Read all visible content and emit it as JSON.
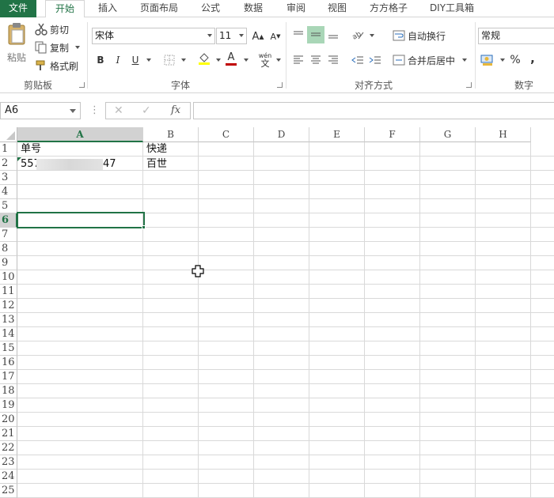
{
  "tabs": [
    "文件",
    "开始",
    "插入",
    "页面布局",
    "公式",
    "数据",
    "审阅",
    "视图",
    "方方格子",
    "DIY工具箱"
  ],
  "clipboard": {
    "paste_label": "粘贴",
    "cut_label": "剪切",
    "copy_label": "复制",
    "format_painter_label": "格式刷",
    "group_label": "剪贴板"
  },
  "font": {
    "name": "宋体",
    "size": "11",
    "grow_label": "A",
    "shrink_label": "A",
    "bold": "B",
    "italic": "I",
    "underline": "U",
    "font_color_label": "A",
    "phonetic_label": "wén",
    "phonetic_sub": "文",
    "group_label": "字体"
  },
  "alignment": {
    "wrap_label": "自动换行",
    "merge_label": "合并后居中",
    "group_label": "对齐方式"
  },
  "number": {
    "format": "常规",
    "percent": "%",
    "comma": ",",
    "group_label": "数字"
  },
  "formula_bar": {
    "name_box": "A6",
    "fx": "fx",
    "cancel": "✕",
    "enter": "✓",
    "menu": "⋮",
    "content": ""
  },
  "columns": [
    "A",
    "B",
    "C",
    "D",
    "E",
    "F",
    "G",
    "H"
  ],
  "rows": [
    "1",
    "2",
    "3",
    "4",
    "5",
    "6",
    "7",
    "8",
    "9",
    "10",
    "11",
    "12",
    "13",
    "14",
    "15",
    "16",
    "17",
    "18",
    "19",
    "20",
    "21",
    "22",
    "23",
    "24",
    "25"
  ],
  "cells": {
    "a1": "单号",
    "b1": "快递",
    "a2_start": "557",
    "a2_end": "47",
    "b2": "百世"
  },
  "colors": {
    "accent": "#217346",
    "selected_button": "#a9d6b7",
    "header_selected": "#d2d2d2",
    "font_color_bar": "#c00000",
    "fill_color_bar": "#ffff00"
  }
}
